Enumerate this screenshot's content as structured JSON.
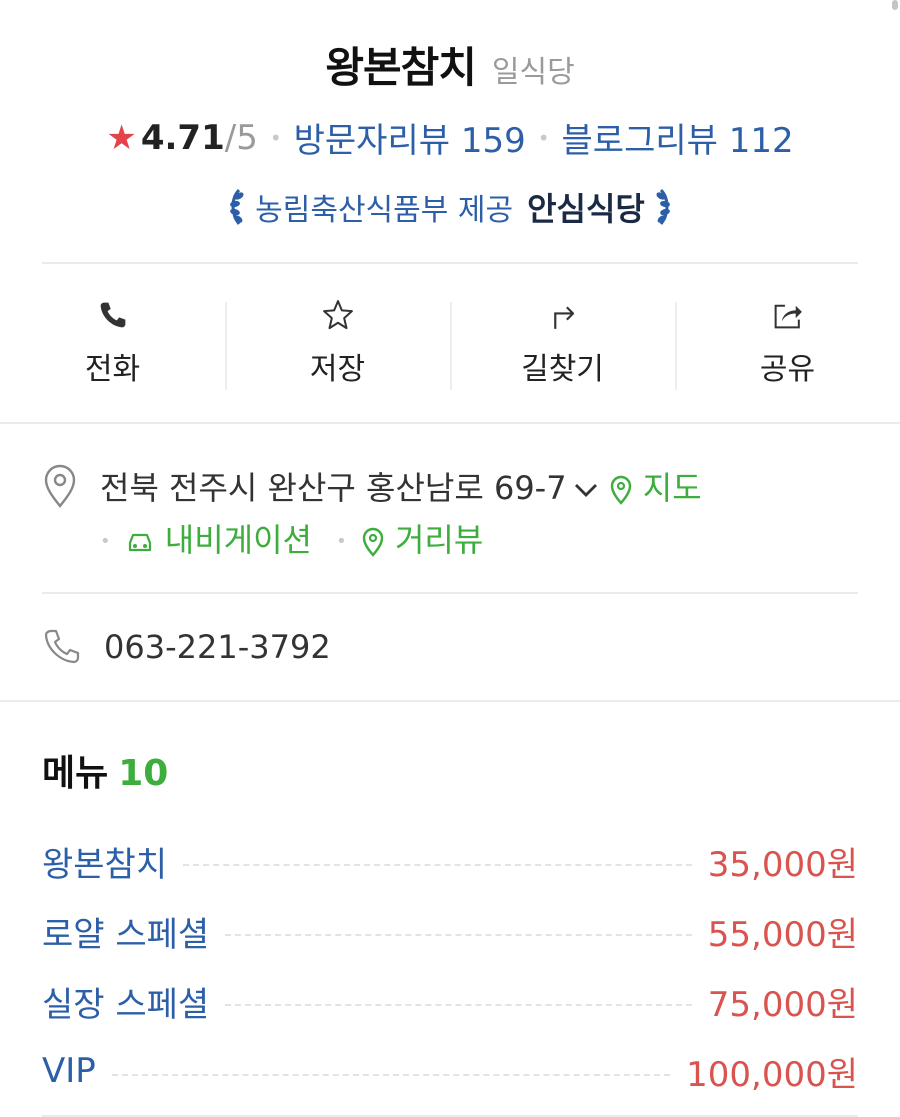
{
  "restaurant": {
    "name": "왕본참치",
    "category": "일식당",
    "rating": "4.71",
    "rating_max": "/5",
    "visitor_reviews_label": "방문자리뷰 159",
    "blog_reviews_label": "블로그리뷰 112",
    "safe_provider": "농림축산식품부 제공",
    "safe_label": "안심식당"
  },
  "actions": [
    {
      "label": "전화",
      "icon": "phone-icon"
    },
    {
      "label": "저장",
      "icon": "star-outline-icon"
    },
    {
      "label": "길찾기",
      "icon": "directions-icon"
    },
    {
      "label": "공유",
      "icon": "share-icon"
    }
  ],
  "info": {
    "address": "전북 전주시 완산구 홍산남로 69-7",
    "map_link": "지도",
    "navigation_link": "내비게이션",
    "streetview_link": "거리뷰",
    "phone": "063-221-3792"
  },
  "menu": {
    "title": "메뉴",
    "count": "10",
    "items": [
      {
        "name": "왕본참치",
        "price": "35,000원"
      },
      {
        "name": "로얄 스페셜",
        "price": "55,000원"
      },
      {
        "name": "실장 스페셜",
        "price": "75,000원"
      },
      {
        "name": "VIP",
        "price": "100,000원"
      }
    ]
  },
  "colors": {
    "link_blue": "#2c5fa8",
    "green": "#3dae3d",
    "price_red": "#d9534f",
    "star_red": "#e5434a"
  }
}
